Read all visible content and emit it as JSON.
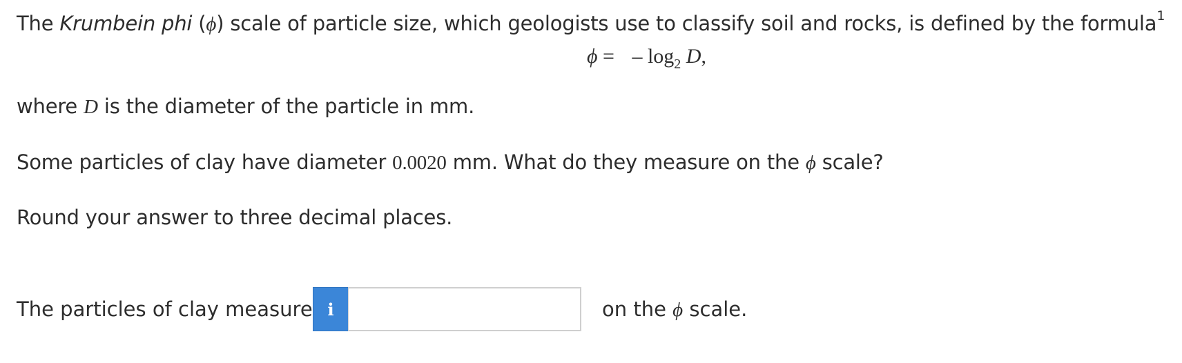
{
  "intro": {
    "prefix": "The ",
    "term": "Krumbein phi",
    "term_open": " (",
    "phi_symbol": "ϕ",
    "term_close": ")",
    "text": " scale of particle size, which geologists use to classify soil and rocks, is defined by the formula",
    "footnote_marker": "1"
  },
  "formula": {
    "lhs": "ϕ",
    "equals": " = ",
    "minus": "– ",
    "log": "log",
    "base": "2",
    "variable": " D",
    "trailing": ","
  },
  "where_line": {
    "prefix": "where ",
    "variable": "D",
    "text": " is the diameter of the particle in mm."
  },
  "question": {
    "prefix": "Some particles of clay have diameter ",
    "value": "0.0020",
    "middle": " mm. What do they measure on the ",
    "phi_symbol": "ϕ",
    "suffix": " scale?"
  },
  "instruction": "Round your answer to three decimal places.",
  "answer": {
    "lead": "The particles of clay measure",
    "info_icon": "info-icon",
    "info_label": "i",
    "value": "",
    "placeholder": "",
    "trail_prefix": "on the ",
    "phi_symbol": "ϕ",
    "trail_suffix": " scale."
  },
  "colors": {
    "text": "#2d2d2d",
    "info_button": "#3b86d8",
    "input_border": "#cfcfcf"
  }
}
